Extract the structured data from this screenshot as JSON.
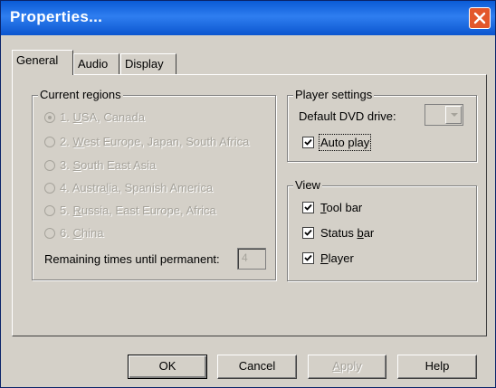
{
  "window": {
    "title": "Properties..."
  },
  "tabs": [
    {
      "label": "General",
      "active": true
    },
    {
      "label": "Audio",
      "active": false
    },
    {
      "label": "Display",
      "active": false
    }
  ],
  "current_regions": {
    "title": "Current regions",
    "options": [
      {
        "num": "1. ",
        "accel": "U",
        "rest": "SA, Canada",
        "selected": true
      },
      {
        "num": "2. ",
        "accel": "W",
        "rest": "est Europe, Japan, South Africa",
        "selected": false
      },
      {
        "num": "3. ",
        "accel": "S",
        "rest": "outh East Asia",
        "selected": false
      },
      {
        "num": "4. Austra",
        "accel": "l",
        "rest": "ia, Spanish America",
        "selected": false
      },
      {
        "num": "5. ",
        "accel": "R",
        "rest": "ussia, East Europe, Africa",
        "selected": false
      },
      {
        "num": "6. ",
        "accel": "C",
        "rest": "hina",
        "selected": false
      }
    ],
    "remaining_label": "Remaining times until permanent:",
    "remaining_value": "4"
  },
  "player_settings": {
    "title": "Player settings",
    "drive_label": "Default DVD drive:",
    "drive_value": "",
    "autoplay_label": "Auto play",
    "autoplay_checked": true
  },
  "view": {
    "title": "View",
    "items": [
      {
        "pre": "",
        "accel": "T",
        "rest": "ool bar",
        "checked": true
      },
      {
        "pre": "Status ",
        "accel": "b",
        "rest": "ar",
        "checked": true
      },
      {
        "pre": "",
        "accel": "P",
        "rest": "layer",
        "checked": true
      }
    ]
  },
  "buttons": {
    "ok": "OK",
    "cancel": "Cancel",
    "apply_accel": "A",
    "apply_rest": "pply",
    "help": "Help"
  }
}
